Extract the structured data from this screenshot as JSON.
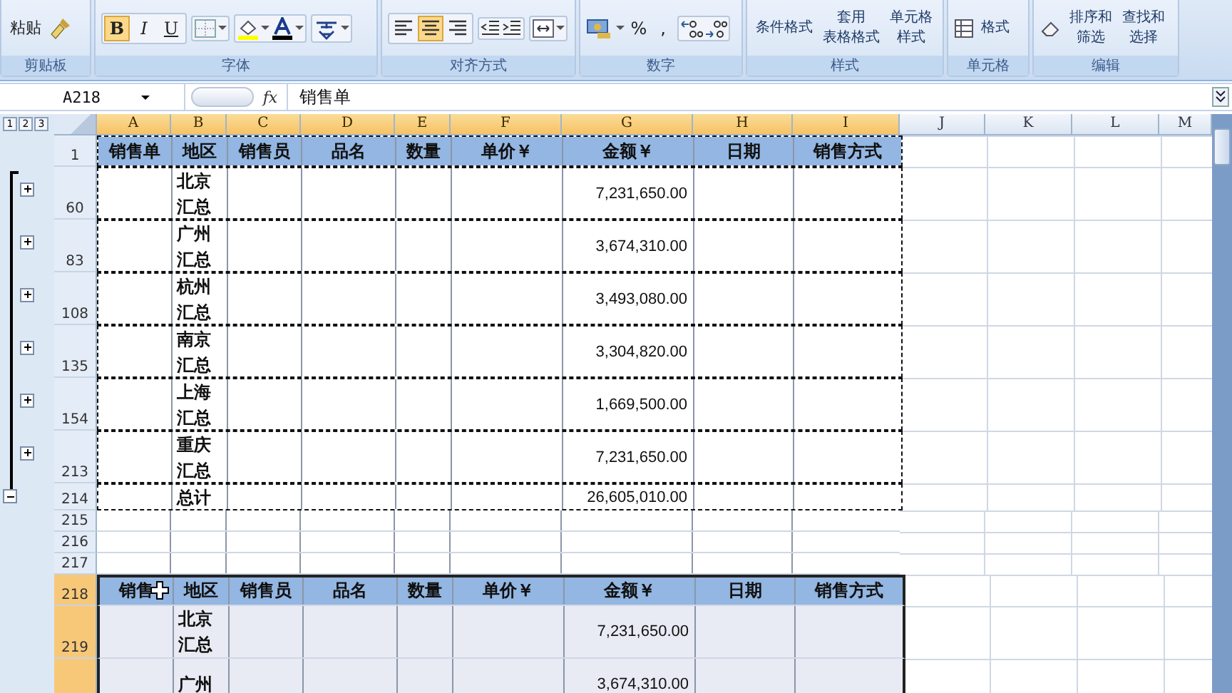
{
  "ribbon": {
    "groups": [
      {
        "kind": "clipboard",
        "label": "剪贴板",
        "paste": "粘贴"
      },
      {
        "kind": "font",
        "label": "字体",
        "buttons": [
          {
            "text": "B",
            "selected": true
          },
          {
            "text": "I",
            "selected": false
          },
          {
            "text": "U",
            "selected": false
          }
        ]
      },
      {
        "kind": "align",
        "label": "对齐方式",
        "buttons": [
          {
            "selected": false
          },
          {
            "selected": true
          },
          {
            "selected": false
          }
        ]
      },
      {
        "kind": "number",
        "label": "数字",
        "symbols": [
          "%",
          ","
        ]
      },
      {
        "kind": "styles",
        "label": "样式",
        "commands": [
          {
            "lines": [
              "条件格式"
            ]
          },
          {
            "lines": [
              "套用",
              "表格格式"
            ]
          },
          {
            "lines": [
              "单元格",
              "样式"
            ]
          }
        ]
      },
      {
        "kind": "cells",
        "label": "单元格",
        "commands": [
          {
            "lines": [
              "格式"
            ]
          }
        ]
      },
      {
        "kind": "editing",
        "label": "编辑",
        "commands": [
          {
            "lines": [
              "排序和",
              "筛选"
            ]
          },
          {
            "lines": [
              "查找和",
              "选择"
            ]
          }
        ]
      }
    ]
  },
  "formula_bar": {
    "name_box": "A218",
    "function_button": "fx",
    "content": "销售单"
  },
  "outline_levels": [
    "1",
    "2",
    "3"
  ],
  "columns": [
    {
      "label": "A",
      "selected": true
    },
    {
      "label": "B",
      "selected": true
    },
    {
      "label": "C",
      "selected": true
    },
    {
      "label": "D",
      "selected": true
    },
    {
      "label": "E",
      "selected": true
    },
    {
      "label": "F",
      "selected": true
    },
    {
      "label": "G",
      "selected": true
    },
    {
      "label": "H",
      "selected": true
    },
    {
      "label": "I",
      "selected": true
    },
    {
      "label": "J",
      "selected": false
    },
    {
      "label": "K",
      "selected": false
    },
    {
      "label": "L",
      "selected": false
    },
    {
      "label": "M",
      "selected": false
    }
  ],
  "rows": [
    {
      "number": "1",
      "kind": "header",
      "selected": false,
      "copied": true,
      "headers": [
        "销售单",
        "地区",
        "销售员",
        "品名",
        "数量",
        "单价￥",
        "金额￥",
        "日期",
        "销售方式"
      ]
    },
    {
      "number": "60",
      "kind": "data",
      "selected": false,
      "copied": true,
      "group_collapsed": true,
      "region": "北京汇总",
      "amount": "7,231,650.00"
    },
    {
      "number": "83",
      "kind": "data",
      "selected": false,
      "copied": true,
      "group_collapsed": true,
      "region": "广州汇总",
      "amount": "3,674,310.00"
    },
    {
      "number": "108",
      "kind": "data",
      "selected": false,
      "copied": true,
      "group_collapsed": true,
      "region": "杭州汇总",
      "amount": "3,493,080.00"
    },
    {
      "number": "135",
      "kind": "data",
      "selected": false,
      "copied": true,
      "group_collapsed": true,
      "region": "南京汇总",
      "amount": "3,304,820.00"
    },
    {
      "number": "154",
      "kind": "data",
      "selected": false,
      "copied": true,
      "group_collapsed": true,
      "region": "上海汇总",
      "amount": "1,669,500.00"
    },
    {
      "number": "213",
      "kind": "data",
      "selected": false,
      "copied": true,
      "group_collapsed": true,
      "region": "重庆汇总",
      "amount": "7,231,650.00"
    },
    {
      "number": "214",
      "kind": "total",
      "selected": false,
      "copied": true,
      "group_collapsed": false,
      "region": "总计",
      "amount": "26,605,010.00"
    },
    {
      "number": "215",
      "kind": "blank",
      "selected": false,
      "copied": false
    },
    {
      "number": "216",
      "kind": "blank",
      "selected": false,
      "copied": false
    },
    {
      "number": "217",
      "kind": "blank",
      "selected": false,
      "copied": false
    },
    {
      "number": "218",
      "kind": "header",
      "selected": true,
      "copied": false,
      "headers": [
        "销售",
        "地区",
        "销售员",
        "品名",
        "数量",
        "单价￥",
        "金额￥",
        "日期",
        "销售方式"
      ]
    },
    {
      "number": "219",
      "kind": "data",
      "selected": true,
      "copied": false,
      "region": "北京汇总",
      "amount": "7,231,650.00"
    },
    {
      "kind": "data",
      "selected": true,
      "copied": false,
      "region": "广州",
      "amount": "3,674,310.00"
    }
  ]
}
